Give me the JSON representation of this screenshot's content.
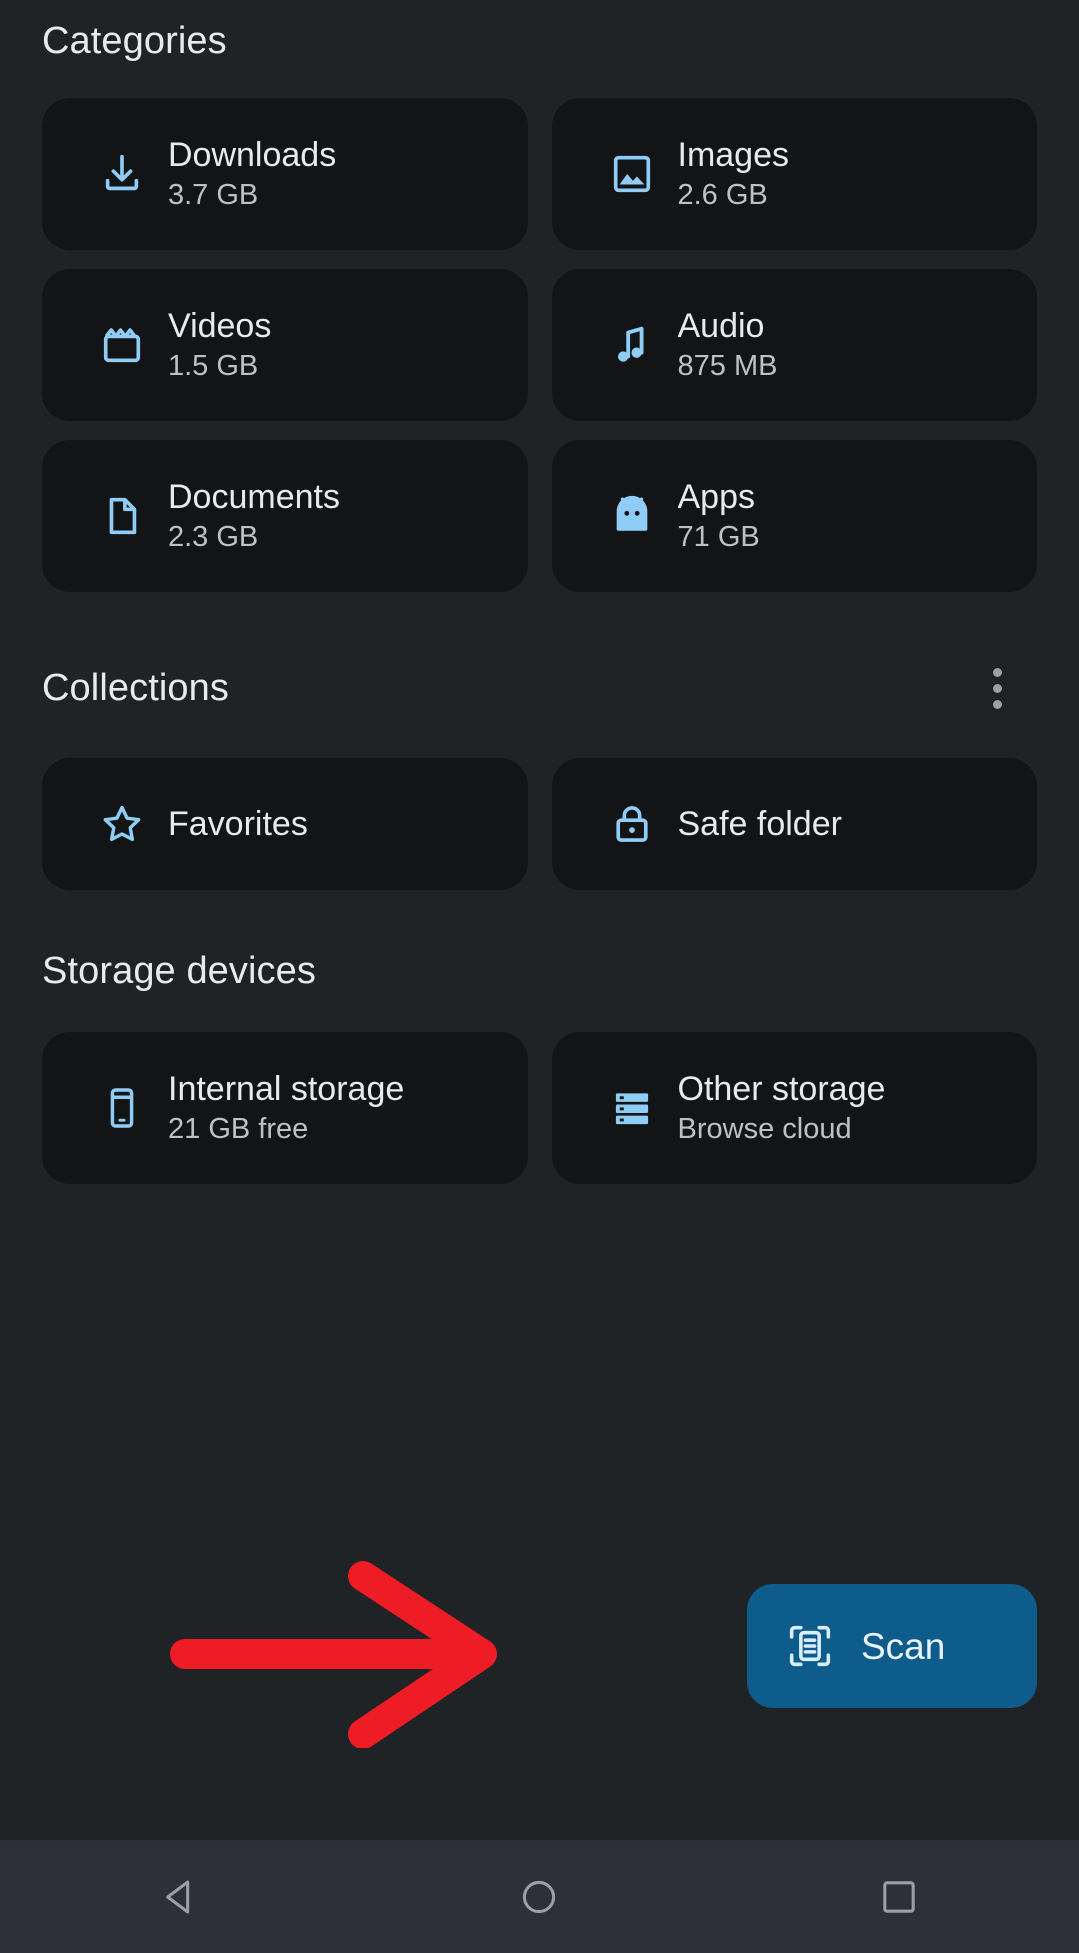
{
  "sections": {
    "categories": {
      "title": "Categories",
      "items": [
        {
          "icon": "download-icon",
          "label": "Downloads",
          "size": "3.7 GB"
        },
        {
          "icon": "image-icon",
          "label": "Images",
          "size": "2.6 GB"
        },
        {
          "icon": "video-icon",
          "label": "Videos",
          "size": "1.5 GB"
        },
        {
          "icon": "audio-icon",
          "label": "Audio",
          "size": "875 MB"
        },
        {
          "icon": "document-icon",
          "label": "Documents",
          "size": "2.3 GB"
        },
        {
          "icon": "apps-icon",
          "label": "Apps",
          "size": "71 GB"
        }
      ]
    },
    "collections": {
      "title": "Collections",
      "overflow_icon": "more-vertical-icon",
      "items": [
        {
          "icon": "star-icon",
          "label": "Favorites"
        },
        {
          "icon": "lock-icon",
          "label": "Safe folder"
        }
      ]
    },
    "storage_devices": {
      "title": "Storage devices",
      "items": [
        {
          "icon": "phone-icon",
          "label": "Internal storage",
          "sub": "21 GB free"
        },
        {
          "icon": "storage-icon",
          "label": "Other storage",
          "sub": "Browse cloud"
        }
      ]
    }
  },
  "scan_button": {
    "label": "Scan",
    "icon": "document-scanner-icon",
    "color": "#0e5c8b",
    "text_color": "#eaf3fb"
  },
  "annotation": {
    "arrow_icon": "red-arrow-right",
    "color": "#ee1c25"
  },
  "navbar": {
    "buttons": [
      {
        "icon": "back-triangle-icon",
        "name": "back"
      },
      {
        "icon": "home-circle-icon",
        "name": "home"
      },
      {
        "icon": "recents-square-icon",
        "name": "recents"
      }
    ]
  },
  "theme": {
    "background": "#202326",
    "card_background": "#131416",
    "icon_accent": "#8fcdf7",
    "title_text": "#e8eaed",
    "sub_text": "#bdc1c6",
    "navbar_background": "#2d3035"
  }
}
